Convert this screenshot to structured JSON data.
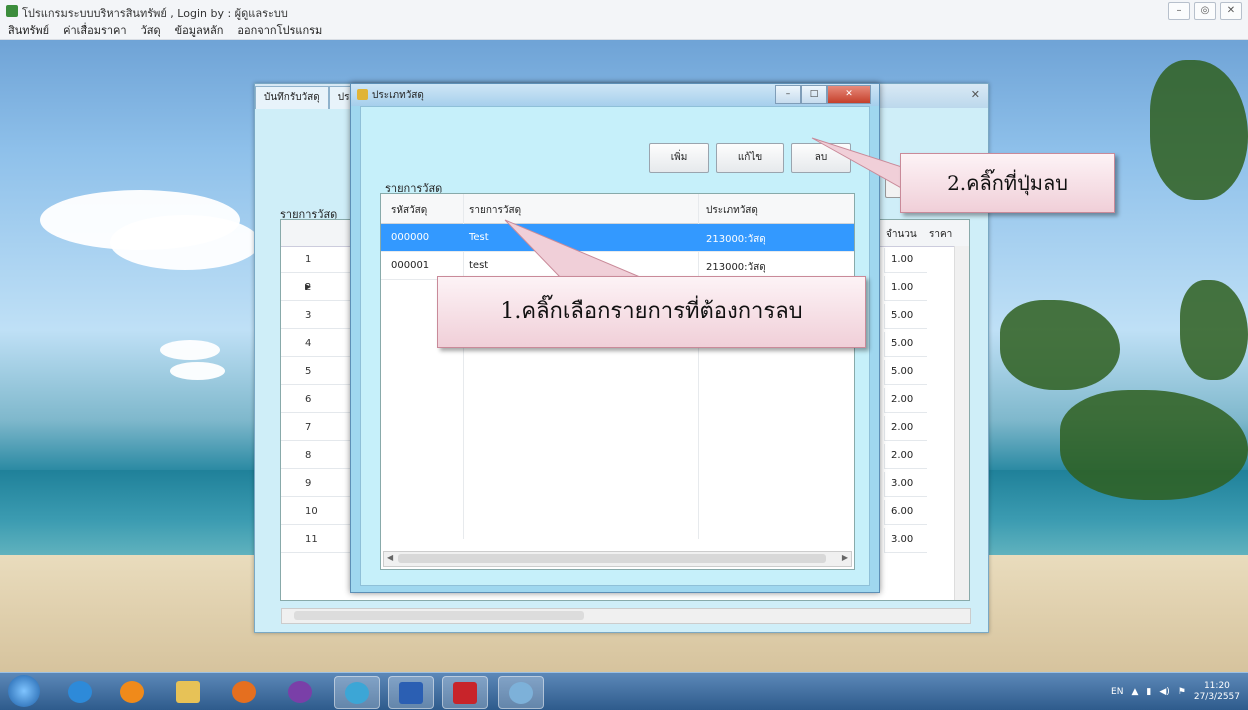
{
  "app": {
    "title": "โปรแกรมระบบบริหารสินทรัพย์ , Login by : ผู้ดูแลระบบ",
    "menu": [
      "สินทรัพย์",
      "ค่าเสื่อมราคา",
      "วัสดุ",
      "ข้อมูลหลัก",
      "ออกจากโปรแกรม"
    ]
  },
  "back_window": {
    "tab_label": "บันทึกรับวัสดุ",
    "section_label": "รายการวัสดุ",
    "col_qty": "จำนวน",
    "col_price": "ราคา",
    "rows": [
      {
        "no": "1",
        "qty": "1.00"
      },
      {
        "no": "2",
        "qty": "1.00"
      },
      {
        "no": "3",
        "qty": "5.00"
      },
      {
        "no": "4",
        "qty": "5.00"
      },
      {
        "no": "5",
        "qty": "5.00"
      },
      {
        "no": "6",
        "qty": "2.00"
      },
      {
        "no": "7",
        "qty": "2.00"
      },
      {
        "no": "8",
        "qty": "2.00"
      },
      {
        "no": "9",
        "qty": "3.00"
      },
      {
        "no": "10",
        "qty": "6.00"
      },
      {
        "no": "11",
        "qty": "3.00"
      }
    ]
  },
  "dialog": {
    "title": "ประเภทวัสดุ",
    "buttons": {
      "add": "เพิ่ม",
      "edit": "แก้ไข",
      "delete": "ลบ"
    },
    "section_label": "รายการวัสดุ",
    "columns": [
      "รหัสวัสดุ",
      "รายการวัสดุ",
      "ประเภทวัสดุ"
    ],
    "rows": [
      {
        "code": "000000",
        "name": "Test",
        "type": "213000:วัสดุ",
        "selected": true
      },
      {
        "code": "000001",
        "name": "test",
        "type": "213000:วัสดุ",
        "selected": false
      }
    ]
  },
  "callouts": {
    "step1": "1.คลิ๊กเลือกรายการที่ต้องการลบ",
    "step2": "2.คลิ๊กที่ปุ่มลบ"
  },
  "taskbar": {
    "lang": "EN",
    "time": "11:20",
    "date": "27/3/2557"
  },
  "colors": {
    "selection": "#3399ff",
    "dialog_bg": "#c6f0fa",
    "callout_fill": "#f0cfd8"
  }
}
